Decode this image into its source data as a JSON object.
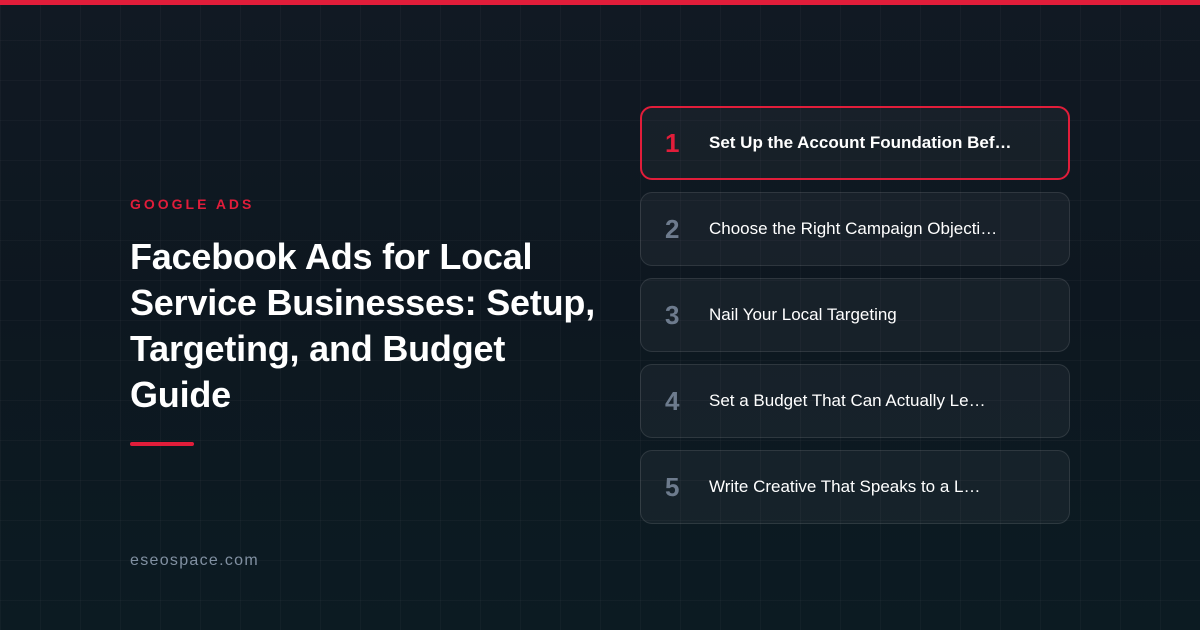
{
  "accent_color": "#e11d3a",
  "header": {
    "category": "GOOGLE ADS"
  },
  "article": {
    "title": "Facebook Ads for Local Service Businesses: Setup, Targeting, and Budget Guide"
  },
  "footer": {
    "domain": "eseospace.com"
  },
  "steps": {
    "active_index": 0,
    "items": [
      {
        "number": "1",
        "label": "Set Up the Account Foundation Bef…"
      },
      {
        "number": "2",
        "label": "Choose the Right Campaign Objecti…"
      },
      {
        "number": "3",
        "label": "Nail Your Local Targeting"
      },
      {
        "number": "4",
        "label": "Set a Budget That Can Actually Le…"
      },
      {
        "number": "5",
        "label": "Write Creative That Speaks to a L…"
      }
    ]
  }
}
